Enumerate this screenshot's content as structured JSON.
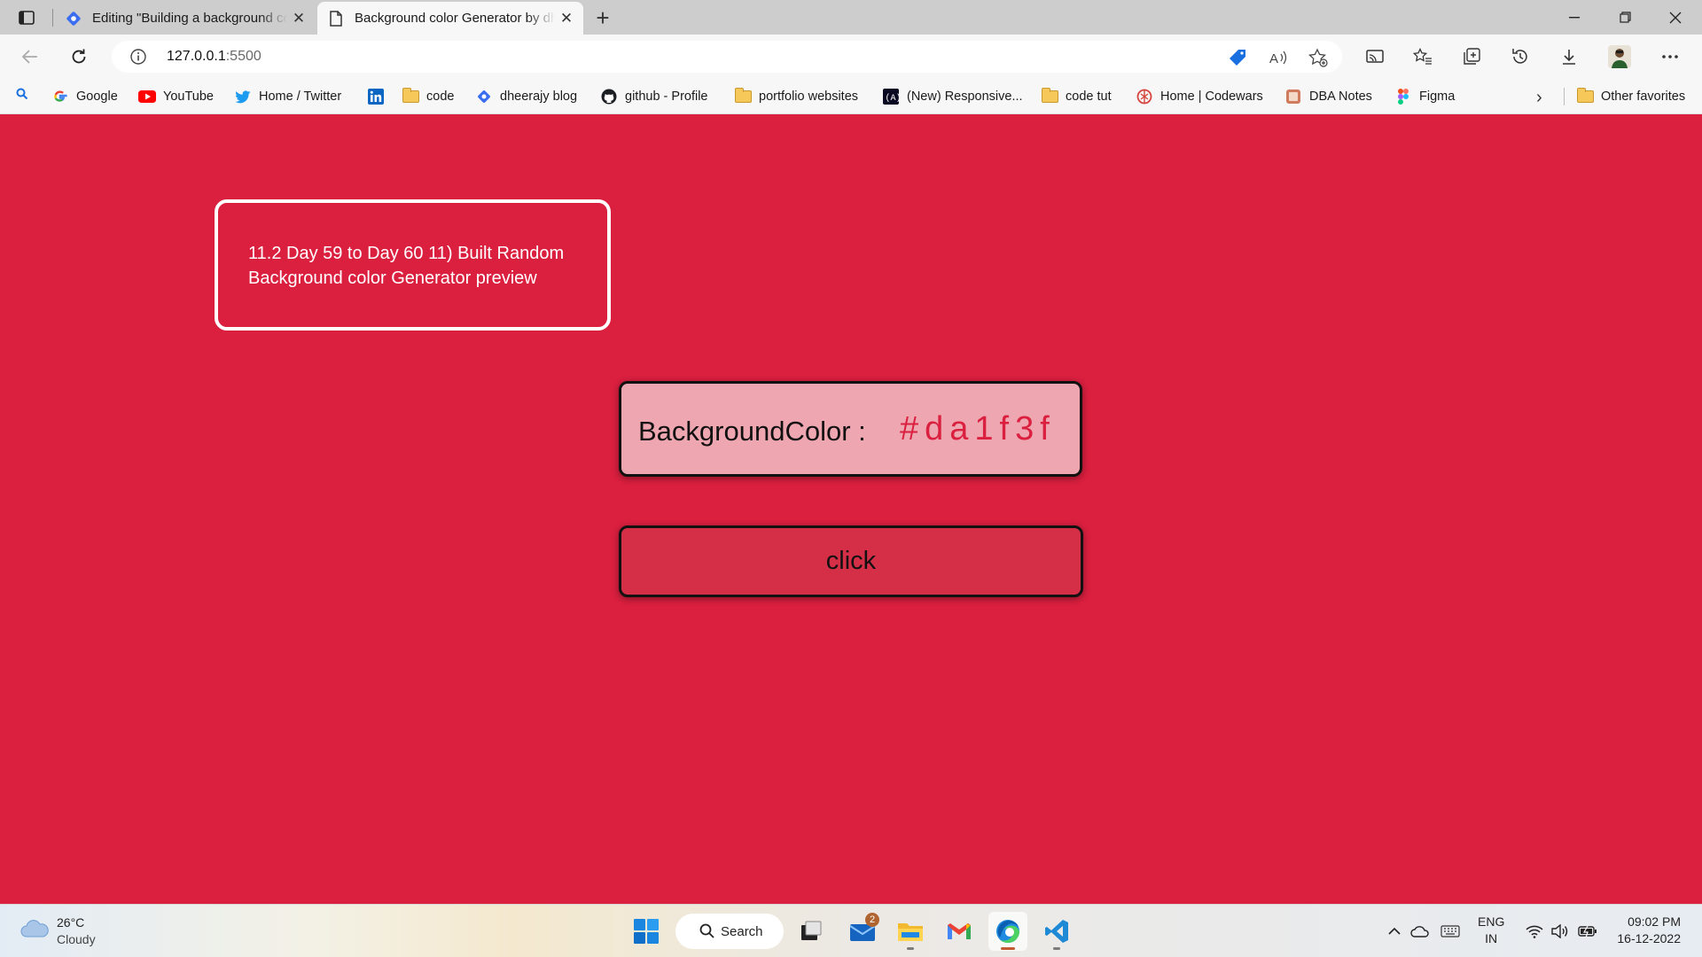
{
  "browser": {
    "tabs": [
      {
        "title": "Editing \"Building a background color Generator\"",
        "active": false,
        "icon": "blog-diamond-icon"
      },
      {
        "title": "Background color Generator by dheerajy",
        "active": true,
        "icon": "page-icon"
      }
    ],
    "address": {
      "host": "127.0.0.1",
      "port": ":5500"
    },
    "favorites": [
      {
        "label": "Google",
        "icon": "google-icon"
      },
      {
        "label": "YouTube",
        "icon": "youtube-icon"
      },
      {
        "label": "Home / Twitter",
        "icon": "twitter-icon"
      },
      {
        "label": "",
        "icon": "linkedin-icon"
      },
      {
        "label": "code",
        "icon": "folder-icon"
      },
      {
        "label": "dheerajy blog",
        "icon": "blog-diamond-icon"
      },
      {
        "label": "github - Profile",
        "icon": "github-icon"
      },
      {
        "label": "portfolio websites",
        "icon": "folder-icon"
      },
      {
        "label": "(New) Responsive...",
        "icon": "freecodecamp-icon"
      },
      {
        "label": "code tut",
        "icon": "folder-icon"
      },
      {
        "label": "Home | Codewars",
        "icon": "codewars-icon"
      },
      {
        "label": "DBA Notes",
        "icon": "notes-icon"
      },
      {
        "label": "Figma",
        "icon": "figma-icon"
      }
    ],
    "other_favorites": "Other favorites"
  },
  "page": {
    "note": "11.2 Day 59 to Day 60  11) Built Random Background color Generator preview",
    "bg_label": "BackgroundColor :",
    "bg_value": "#da1f3f",
    "button_label": "click",
    "colors": {
      "background": "#da1f3f",
      "display_box": "#eea6b0",
      "button": "#d42f47"
    }
  },
  "taskbar": {
    "weather": {
      "temp": "26°C",
      "condition": "Cloudy"
    },
    "search_label": "Search",
    "mail_badge": "2",
    "lang": {
      "line1": "ENG",
      "line2": "IN"
    },
    "clock": {
      "time": "09:02 PM",
      "date": "16-12-2022"
    }
  }
}
